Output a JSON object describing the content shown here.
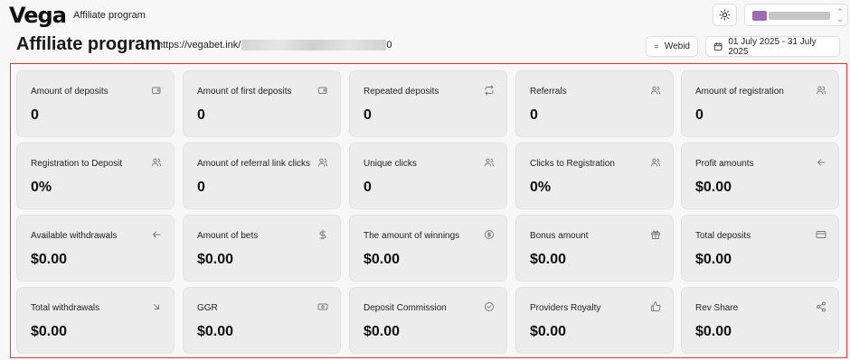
{
  "topbar": {
    "logo": "Vega",
    "title": "Affiliate program"
  },
  "header": {
    "page_title": "Affiliate program",
    "ref_link_prefix": "https://vegabet.ink/",
    "ref_link_suffix": "0",
    "webid_label": "Webid",
    "date_range": "01 July 2025 - 31 July 2025"
  },
  "cards": [
    {
      "label": "Amount of deposits",
      "value": "0",
      "icon": "wallet-icon"
    },
    {
      "label": "Amount of first deposits",
      "value": "0",
      "icon": "wallet-icon"
    },
    {
      "label": "Repeated deposits",
      "value": "0",
      "icon": "repeat-icon"
    },
    {
      "label": "Referrals",
      "value": "0",
      "icon": "users-icon"
    },
    {
      "label": "Amount of registration",
      "value": "0",
      "icon": "users-icon"
    },
    {
      "label": "Registration to Deposit",
      "value": "0%",
      "icon": "users-icon"
    },
    {
      "label": "Amount of referral link clicks",
      "value": "0",
      "icon": "users-icon"
    },
    {
      "label": "Unique clicks",
      "value": "0",
      "icon": "users-icon"
    },
    {
      "label": "Clicks to Registration",
      "value": "0%",
      "icon": "users-icon"
    },
    {
      "label": "Profit amounts",
      "value": "$0.00",
      "icon": "arrow-left-icon"
    },
    {
      "label": "Available withdrawals",
      "value": "$0.00",
      "icon": "arrow-left-icon"
    },
    {
      "label": "Amount of bets",
      "value": "$0.00",
      "icon": "dollar-icon"
    },
    {
      "label": "The amount of winnings",
      "value": "$0.00",
      "icon": "dollar-circle-icon"
    },
    {
      "label": "Bonus amount",
      "value": "$0.00",
      "icon": "gift-icon"
    },
    {
      "label": "Total deposits",
      "value": "$0.00",
      "icon": "card-icon"
    },
    {
      "label": "Total withdrawals",
      "value": "$0.00",
      "icon": "arrow-down-right-icon"
    },
    {
      "label": "GGR",
      "value": "$0.00",
      "icon": "banknote-icon"
    },
    {
      "label": "Deposit Commission",
      "value": "$0.00",
      "icon": "badge-check-icon"
    },
    {
      "label": "Providers Royalty",
      "value": "$0.00",
      "icon": "thumbs-up-icon"
    },
    {
      "label": "Rev Share",
      "value": "$0.00",
      "icon": "share-icon"
    }
  ],
  "colors": {
    "highlight_border": "#e53935",
    "avatar": "#a06ab0"
  }
}
